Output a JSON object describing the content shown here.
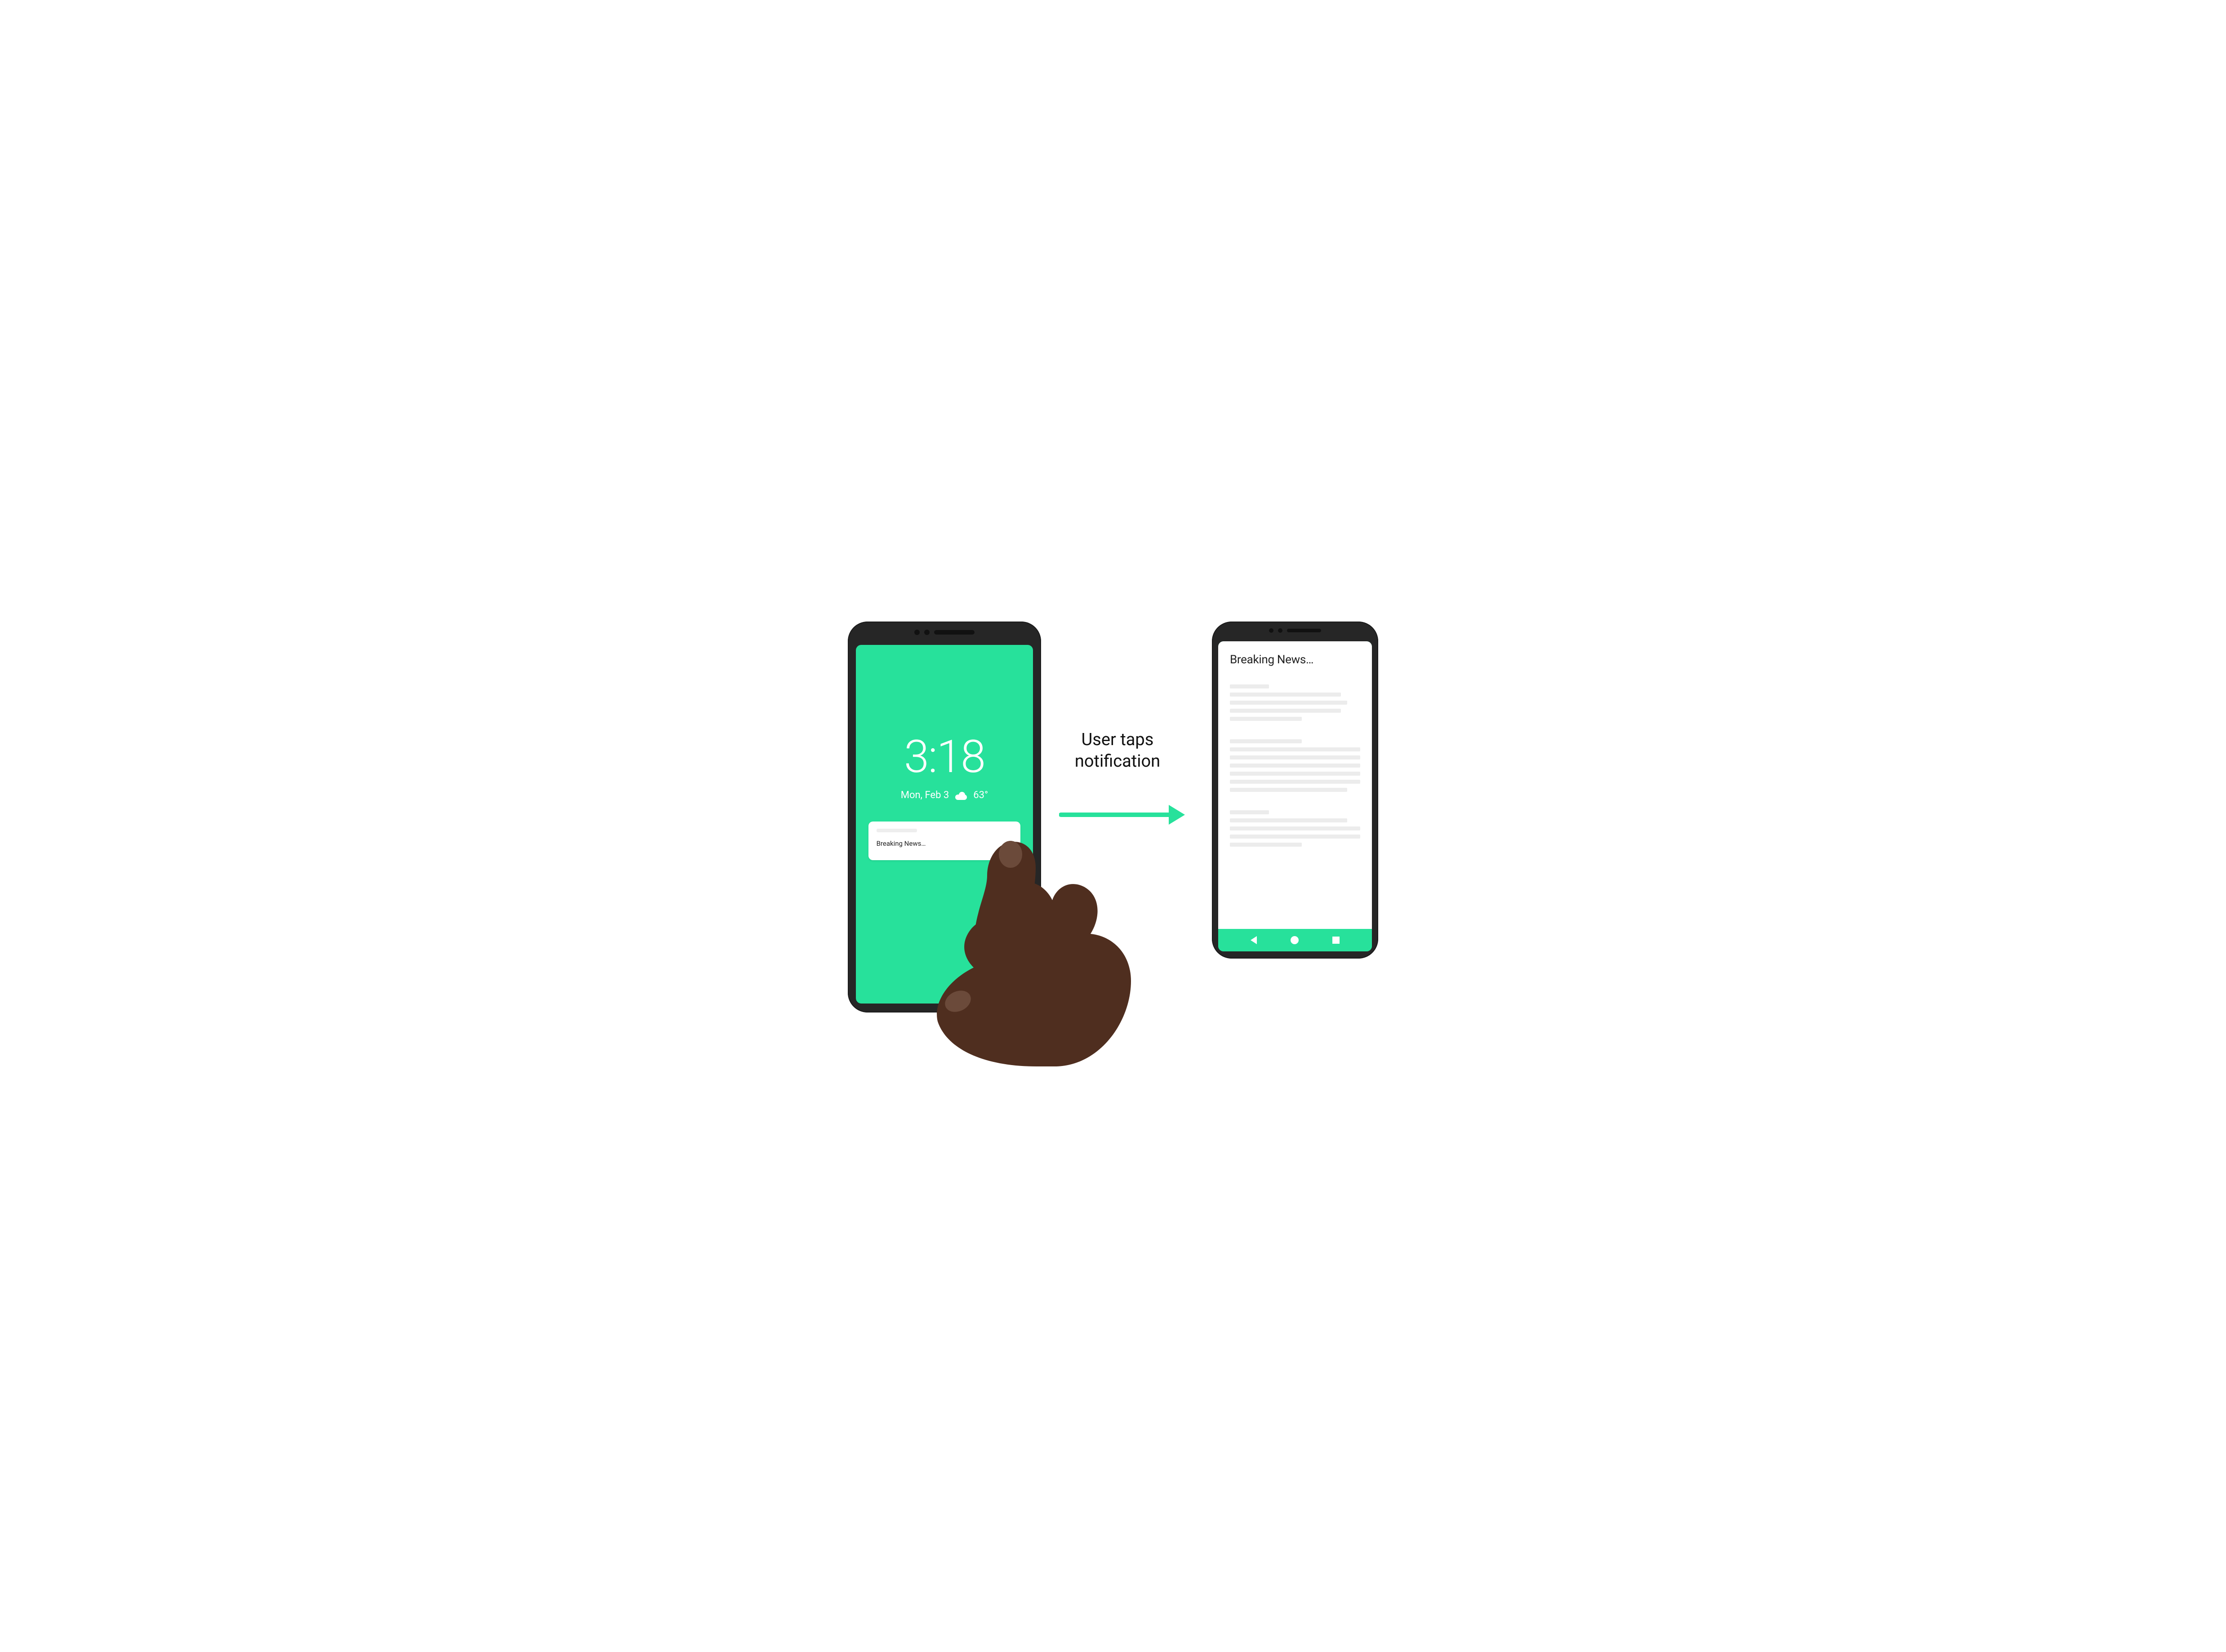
{
  "caption": "User taps notification",
  "colors": {
    "accent": "#27e19b",
    "phone_frame": "#262626",
    "text_dark": "#111111",
    "placeholder": "#ececec",
    "skin": "#4f2e1f",
    "nail": "#6b4a3a"
  },
  "phone_left": {
    "lockscreen": {
      "time": "3:18",
      "date": "Mon, Feb 3",
      "weather_icon": "cloud",
      "temperature": "63°"
    },
    "notification": {
      "title": "Breaking News…"
    }
  },
  "phone_right": {
    "article": {
      "title": "Breaking News…"
    },
    "navbar": {
      "back": "back",
      "home": "home",
      "recents": "recents"
    }
  }
}
